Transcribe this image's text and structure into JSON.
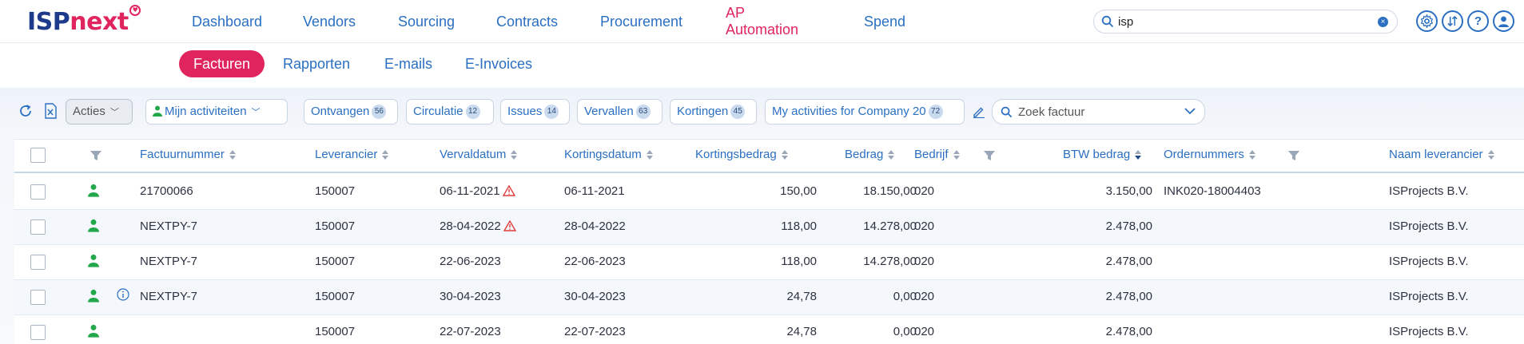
{
  "logo": {
    "part1": "ISP",
    "part2": "next"
  },
  "nav": {
    "items": [
      {
        "label": "Dashboard"
      },
      {
        "label": "Vendors"
      },
      {
        "label": "Sourcing"
      },
      {
        "label": "Contracts"
      },
      {
        "label": "Procurement"
      },
      {
        "label": "AP Automation",
        "active": true
      },
      {
        "label": "Spend"
      }
    ]
  },
  "search": {
    "value": "isp"
  },
  "header_icons": [
    "settings-icon",
    "sync-icon",
    "help-icon",
    "user-icon"
  ],
  "subnav": {
    "tabs": [
      {
        "label": "Facturen",
        "active": true
      },
      {
        "label": "Rapporten"
      },
      {
        "label": "E-mails"
      },
      {
        "label": "E-Invoices"
      }
    ]
  },
  "toolbar": {
    "acties": "Acties",
    "mijn": "Mijn activiteiten",
    "filters": [
      {
        "label": "Ontvangen",
        "count": "56"
      },
      {
        "label": "Circulatie",
        "count": "12"
      },
      {
        "label": "Issues",
        "count": "14"
      },
      {
        "label": "Vervallen",
        "count": "63"
      },
      {
        "label": "Kortingen",
        "count": "45"
      },
      {
        "label": "My activities for Company 20",
        "count": "72"
      }
    ],
    "search_placeholder": "Zoek factuur"
  },
  "table": {
    "headers": {
      "factuurnummer": "Factuurnummer",
      "leverancier": "Leverancier",
      "vervaldatum": "Vervaldatum",
      "kortingsdatum": "Kortingsdatum",
      "kortingsbedrag": "Kortingsbedrag",
      "bedrag": "Bedrag",
      "bedrijf": "Bedrijf",
      "btw": "BTW bedrag",
      "ordernummers": "Ordernummers",
      "naam": "Naam leverancier"
    },
    "rows": [
      {
        "factuur": "21700066",
        "leverancier": "150007",
        "verval": "06-11-2021",
        "warn": true,
        "korting_datum": "06-11-2021",
        "korting_bedrag": "150,00",
        "bedrag": "18.150,00",
        "bedrijf": "020",
        "btw": "3.150,00",
        "order": "INK020-18004403",
        "naam": "ISProjects B.V.",
        "info": false
      },
      {
        "factuur": "NEXTPY-7",
        "leverancier": "150007",
        "verval": "28-04-2022",
        "warn": true,
        "korting_datum": "28-04-2022",
        "korting_bedrag": "118,00",
        "bedrag": "14.278,00",
        "bedrijf": "020",
        "btw": "2.478,00",
        "order": "",
        "naam": "ISProjects B.V.",
        "info": false
      },
      {
        "factuur": "NEXTPY-7",
        "leverancier": "150007",
        "verval": "22-06-2023",
        "warn": false,
        "korting_datum": "22-06-2023",
        "korting_bedrag": "118,00",
        "bedrag": "14.278,00",
        "bedrijf": "020",
        "btw": "2.478,00",
        "order": "",
        "naam": "ISProjects B.V.",
        "info": false
      },
      {
        "factuur": "NEXTPY-7",
        "leverancier": "150007",
        "verval": "30-04-2023",
        "warn": false,
        "korting_datum": "30-04-2023",
        "korting_bedrag": "24,78",
        "bedrag": "0,00",
        "bedrijf": "020",
        "btw": "2.478,00",
        "order": "",
        "naam": "ISProjects B.V.",
        "info": true
      },
      {
        "factuur": "",
        "leverancier": "150007",
        "verval": "22-07-2023",
        "warn": false,
        "korting_datum": "22-07-2023",
        "korting_bedrag": "24,78",
        "bedrag": "0,00",
        "bedrijf": "020",
        "btw": "2.478,00",
        "order": "",
        "naam": "ISProjects B.V.",
        "info": false
      }
    ]
  },
  "colors": {
    "primary": "#2a6fc2",
    "accent": "#e0245e",
    "success": "#22a84a",
    "warning": "#e23c3c"
  }
}
